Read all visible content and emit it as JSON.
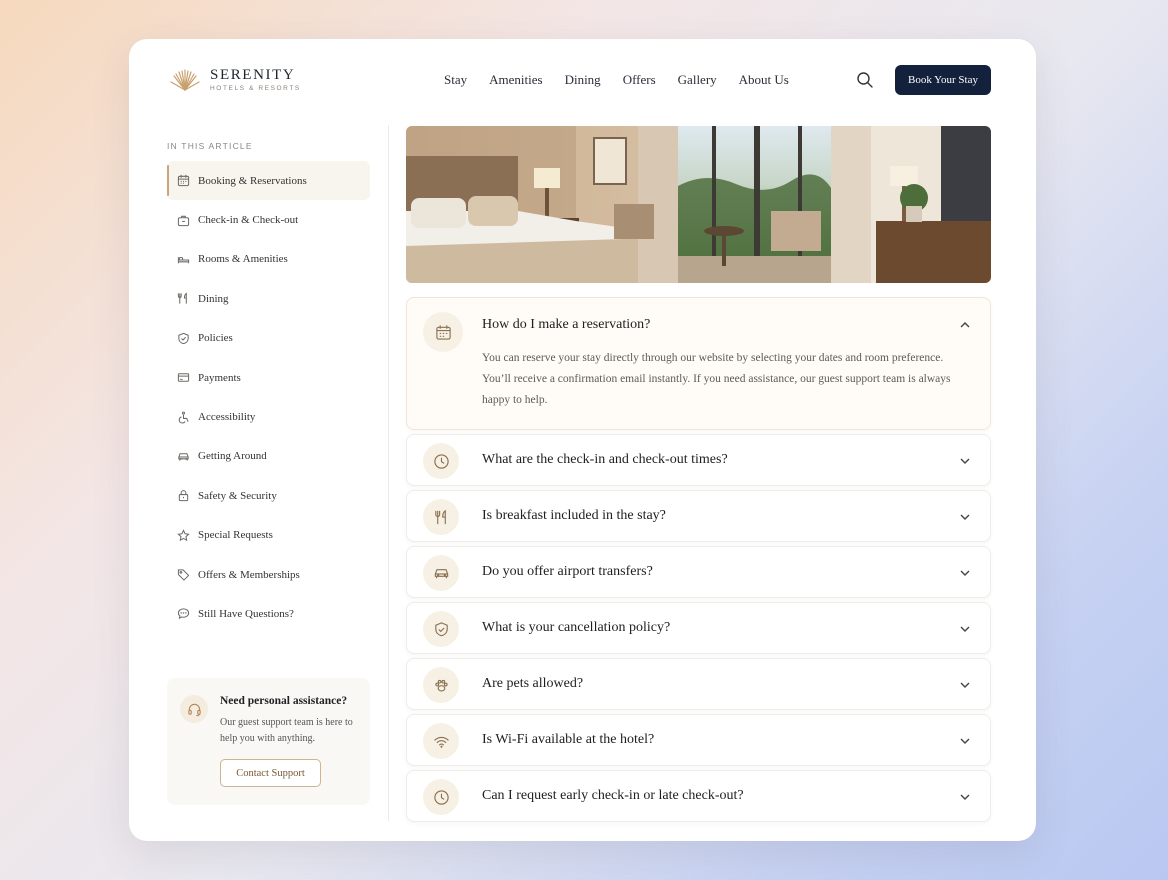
{
  "brand": {
    "name": "SERENITY",
    "tagline": "HOTELS & RESORTS"
  },
  "nav": {
    "items": [
      "Stay",
      "Amenities",
      "Dining",
      "Offers",
      "Gallery",
      "About Us"
    ],
    "book_label": "Book Your Stay"
  },
  "sidebar": {
    "heading": "IN THIS ARTICLE",
    "items": [
      {
        "label": "Booking & Reservations",
        "icon": "calendar-icon",
        "active": true
      },
      {
        "label": "Check-in & Check-out",
        "icon": "suitcase-icon"
      },
      {
        "label": "Rooms & Amenities",
        "icon": "bed-icon"
      },
      {
        "label": "Dining",
        "icon": "utensils-icon"
      },
      {
        "label": "Policies",
        "icon": "shield-icon"
      },
      {
        "label": "Payments",
        "icon": "credit-card-icon"
      },
      {
        "label": "Accessibility",
        "icon": "wheelchair-icon"
      },
      {
        "label": "Getting Around",
        "icon": "car-icon"
      },
      {
        "label": "Safety & Security",
        "icon": "lock-icon"
      },
      {
        "label": "Special Requests",
        "icon": "star-icon"
      },
      {
        "label": "Offers & Memberships",
        "icon": "tag-icon"
      },
      {
        "label": "Still Have Questions?",
        "icon": "chat-icon"
      }
    ]
  },
  "assist": {
    "title": "Need personal assistance?",
    "text": "Our guest support team is here to help you with anything.",
    "button": "Contact Support"
  },
  "faqs": [
    {
      "q": "How do I make a reservation?",
      "icon": "calendar-icon",
      "open": true,
      "a": "You can reserve your stay directly through our website by selecting your dates and room preference. You’ll receive a confirmation email instantly. If you need assistance, our guest support team is always happy to help."
    },
    {
      "q": "What are the check-in and check-out times?",
      "icon": "clock-icon"
    },
    {
      "q": "Is breakfast included in the stay?",
      "icon": "utensils-icon"
    },
    {
      "q": "Do you offer airport transfers?",
      "icon": "car-icon"
    },
    {
      "q": "What is your cancellation policy?",
      "icon": "shield-check-icon"
    },
    {
      "q": "Are pets allowed?",
      "icon": "paw-icon"
    },
    {
      "q": "Is Wi-Fi available at the hotel?",
      "icon": "wifi-icon"
    },
    {
      "q": "Can I request early check-in or late check-out?",
      "icon": "clock-icon"
    }
  ],
  "colors": {
    "accent": "#c8a57a",
    "navy": "#14213d"
  }
}
